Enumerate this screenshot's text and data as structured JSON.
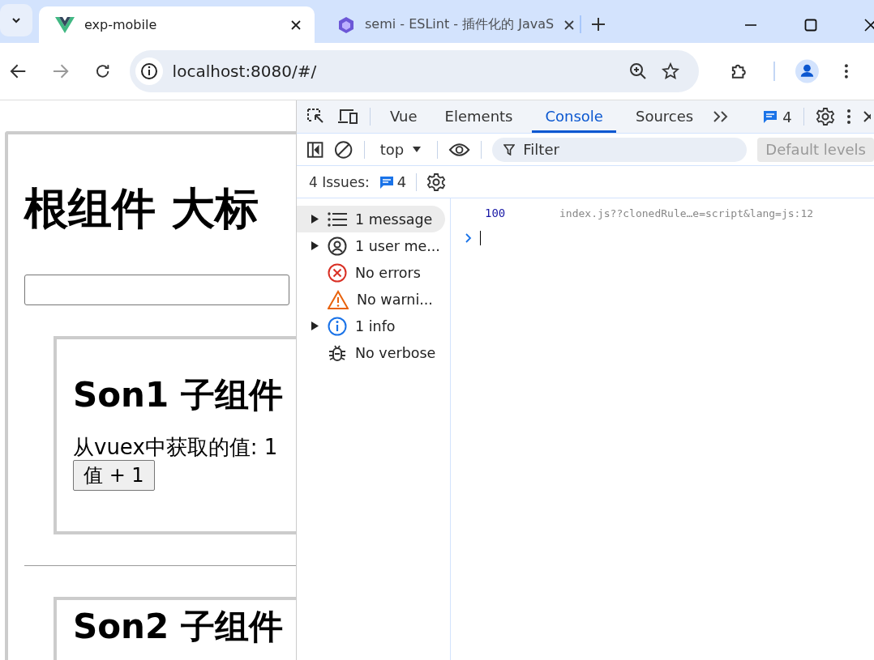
{
  "browser": {
    "tabs": [
      {
        "title": "exp-mobile",
        "kind": "vue",
        "selected": true
      },
      {
        "title": "semi - ESLint - 插件化的 JavaS",
        "kind": "hexagon",
        "selected": false
      }
    ],
    "address": "localhost:8080/#/"
  },
  "page": {
    "heading": "根组件 大标",
    "children": [
      {
        "heading": "Son1 子组件",
        "text": "从vuex中获取的值: 1",
        "button": "值 + 1"
      },
      {
        "heading": "Son2 子组件"
      }
    ]
  },
  "devtools": {
    "tabs": [
      {
        "label": "Vue",
        "selected": false
      },
      {
        "label": "Elements",
        "selected": false
      },
      {
        "label": "Console",
        "selected": true
      },
      {
        "label": "Sources",
        "selected": false
      }
    ],
    "message_count": "4",
    "context": "top",
    "filter_placeholder": "Filter",
    "levels": "Default levels",
    "issues_label": "4 Issues:",
    "issues_count": "4",
    "sidebar": [
      {
        "kind": "list",
        "label": "1 message",
        "expandable": true,
        "selected": true
      },
      {
        "kind": "user",
        "label": "1 user me...",
        "expandable": true,
        "selected": false
      },
      {
        "kind": "error",
        "label": "No errors",
        "expandable": false,
        "selected": false
      },
      {
        "kind": "warning",
        "label": "No warni...",
        "expandable": false,
        "selected": false
      },
      {
        "kind": "info",
        "label": "1 info",
        "expandable": true,
        "selected": false
      },
      {
        "kind": "verbose",
        "label": "No verbose",
        "expandable": false,
        "selected": false
      }
    ],
    "messages": [
      {
        "value": "100",
        "source": "index.js??clonedRule…e=script&lang=js:12"
      }
    ]
  }
}
